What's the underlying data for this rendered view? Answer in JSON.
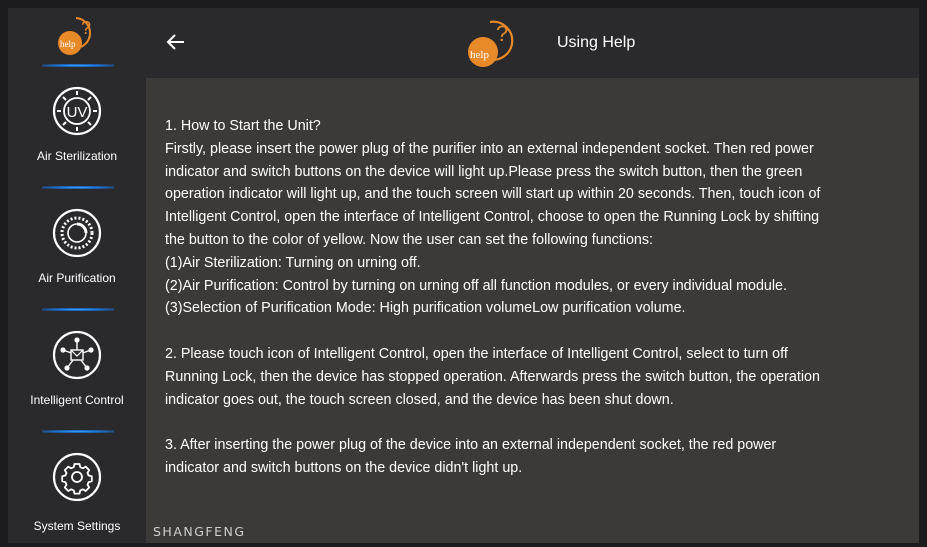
{
  "sidebar": {
    "logo_text": "help",
    "logo_mark": "?",
    "items": [
      {
        "label": "Air Sterilization",
        "icon": "uv-icon",
        "icon_text": "UV"
      },
      {
        "label": "Air Purification",
        "icon": "fan-dial-icon"
      },
      {
        "label": "Intelligent Control",
        "icon": "network-hub-icon"
      },
      {
        "label": "System Settings",
        "icon": "gear-icon"
      }
    ]
  },
  "header": {
    "title": "Using Help",
    "logo_text": "help",
    "logo_mark": "?"
  },
  "content": {
    "lines": [
      "1. How to Start the Unit?",
      " Firstly, please insert the power plug of the purifier into an external independent socket. Then red power",
      "indicator and switch buttons on the device will light up.Please press the switch button, then the green",
      "operation indicator will light up, and the touch screen will start up within 20 seconds. Then, touch icon of",
      "Intelligent Control, open the interface of Intelligent Control, choose to open the Running Lock by shifting",
      "the button to the color of yellow. Now the user can set the following functions:",
      " (1)Air Sterilization: Turning on urning off.",
      " (2)Air Purification: Control by turning on urning off all function modules, or every individual module.",
      " (3)Selection of Purification Mode: High purification volumeLow purification volume.",
      "",
      " 2. Please touch icon of Intelligent Control, open the interface of Intelligent Control, select to turn off",
      "Running Lock, then the device has stopped operation. Afterwards press the switch button, the operation",
      "indicator goes out, the touch screen closed, and the device has been shut down.",
      "",
      " 3. After inserting the power plug of the device into an external independent socket, the red power",
      "indicator and switch buttons on the device didn't light up."
    ]
  },
  "brand": "SHANGFENG",
  "colors": {
    "background": "#3b3a38",
    "bar": "#2a2a2c",
    "accent_orange": "#e8892a",
    "divider_blue": "#2a8cf0",
    "text": "#ffffff"
  }
}
